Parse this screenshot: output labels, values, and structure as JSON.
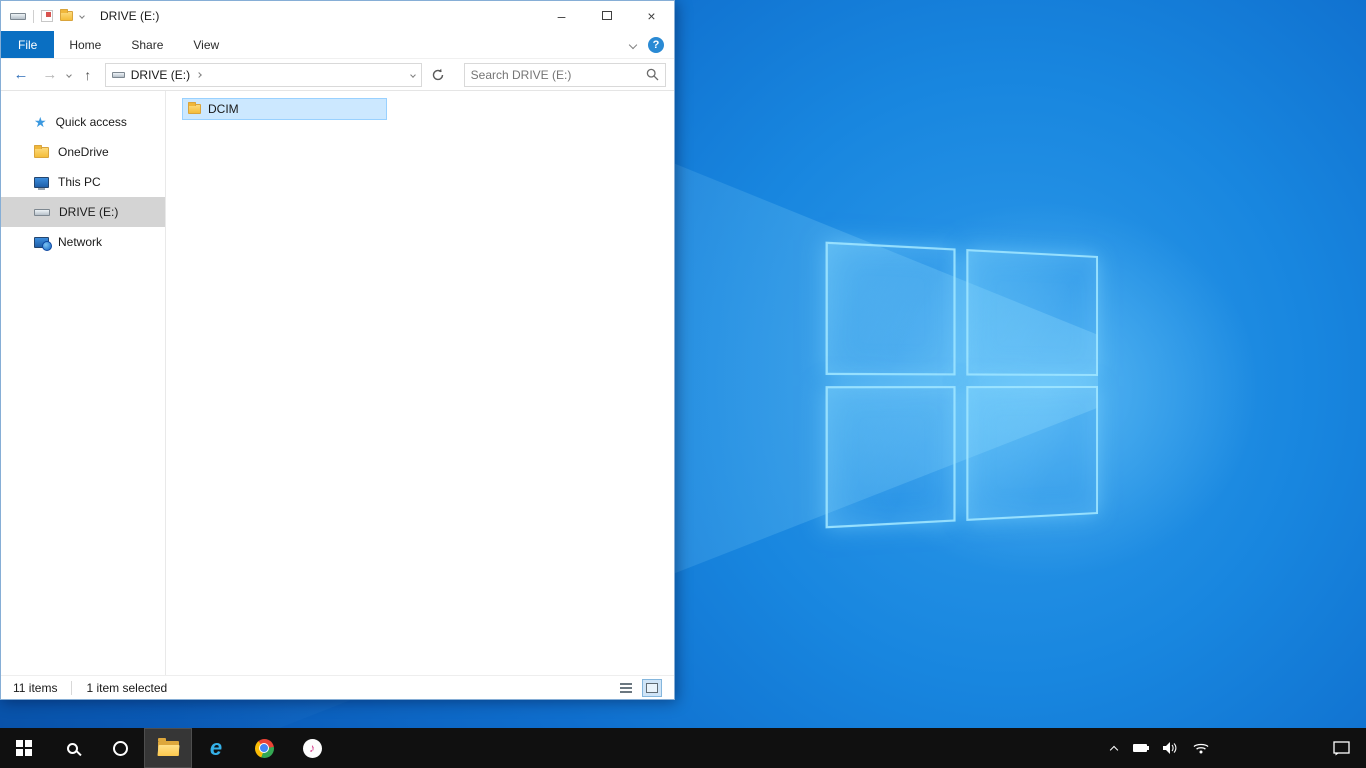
{
  "window": {
    "title": "DRIVE (E:)",
    "controls": {
      "minimize": "–",
      "close": "×"
    }
  },
  "ribbon": {
    "tabs": [
      {
        "label": "File"
      },
      {
        "label": "Home"
      },
      {
        "label": "Share"
      },
      {
        "label": "View"
      }
    ],
    "help_glyph": "?"
  },
  "address": {
    "breadcrumb": "DRIVE (E:)"
  },
  "search": {
    "placeholder": "Search DRIVE (E:)"
  },
  "sidebar": {
    "items": [
      {
        "label": "Quick access",
        "icon": "star",
        "selected": false
      },
      {
        "label": "OneDrive",
        "icon": "folder",
        "selected": false
      },
      {
        "label": "This PC",
        "icon": "computer",
        "selected": false
      },
      {
        "label": "DRIVE (E:)",
        "icon": "drive",
        "selected": true
      },
      {
        "label": "Network",
        "icon": "network",
        "selected": false
      }
    ]
  },
  "files": [
    {
      "name": "DCIM",
      "icon": "folder",
      "selected": true
    }
  ],
  "status": {
    "items_count": "11 items",
    "selection": "1 item selected"
  },
  "icons": {
    "star": "★",
    "music_note": "♪",
    "ie": "e",
    "back": "←",
    "forward": "→",
    "up": "↑"
  },
  "colors": {
    "accent": "#0a6fc2",
    "selection_fill": "#cce8ff",
    "selection_border": "#99d1ff",
    "sidebar_selected": "#d4d4d4",
    "taskbar": "#101010",
    "desktop": "#0f6ecd",
    "folder": "#f4bd3a"
  }
}
